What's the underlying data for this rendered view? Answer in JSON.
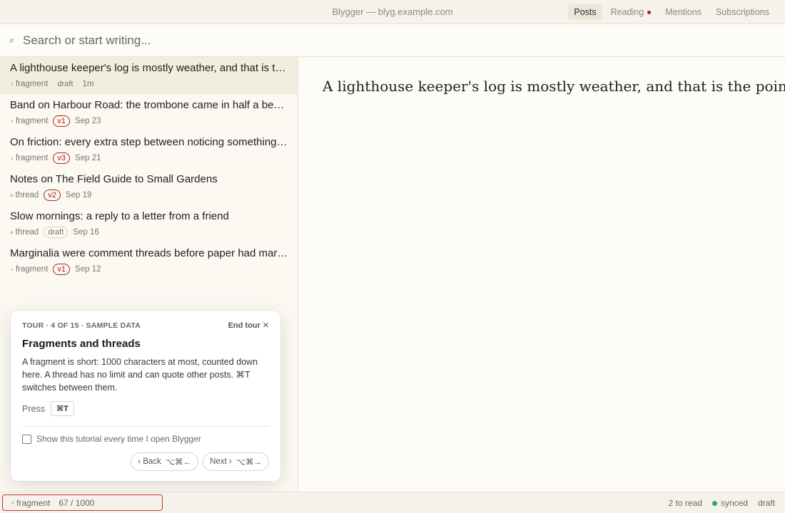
{
  "app": {
    "title": "Blygger — blyg.example.com"
  },
  "nav": {
    "tabs": [
      {
        "label": "Posts"
      },
      {
        "label": "Reading"
      },
      {
        "label": "Mentions"
      },
      {
        "label": "Subscriptions"
      }
    ]
  },
  "search": {
    "placeholder": "Search or start writing..."
  },
  "posts": [
    {
      "title": "A lighthouse keeper's log is mostly weather, and that is the point.",
      "kind": "fragment",
      "badge": "draft",
      "date": "1m"
    },
    {
      "title": "Band on Harbour Road: the trombone came in half a beat early",
      "kind": "fragment",
      "badge": "v1",
      "date": "Sep 23"
    },
    {
      "title": "On friction: every extra step between noticing something and writing it down",
      "kind": "fragment",
      "badge": "v3",
      "date": "Sep 21"
    },
    {
      "title": "Notes on The Field Guide to Small Gardens",
      "kind": "thread",
      "badge": "v2",
      "date": "Sep 19"
    },
    {
      "title": "Slow mornings: a reply to a letter from a friend",
      "kind": "thread",
      "badge": "draft",
      "date": "Sep 16"
    },
    {
      "title": "Marginalia were comment threads before paper had margins",
      "kind": "fragment",
      "badge": "v1",
      "date": "Sep 12"
    }
  ],
  "editor": {
    "text": "A lighthouse keeper's log is mostly weather, and that is the point."
  },
  "tour": {
    "step": "TOUR · 4 OF 15 · SAMPLE DATA",
    "end_label": "End tour",
    "title": "Fragments and threads",
    "body": "A fragment is short: 1000 characters at most, counted down here. A thread has no limit and can quote other posts. ⌘T switches between them.",
    "press_label": "Press",
    "shortcut": "⌘T",
    "checkbox_label": "Show this tutorial every time I open Blygger",
    "back_label": "‹ Back",
    "back_shortcut": "⌥⌘←",
    "next_label": "Next ›",
    "next_shortcut": "⌥⌘→"
  },
  "status": {
    "kind": "fragment",
    "count": "67 / 1000",
    "to_read": "2 to read",
    "sync": "synced",
    "state": "draft"
  },
  "colors": {
    "accent": "#a8261c",
    "synced": "#3ba55c",
    "highlight": "#c9362a"
  }
}
